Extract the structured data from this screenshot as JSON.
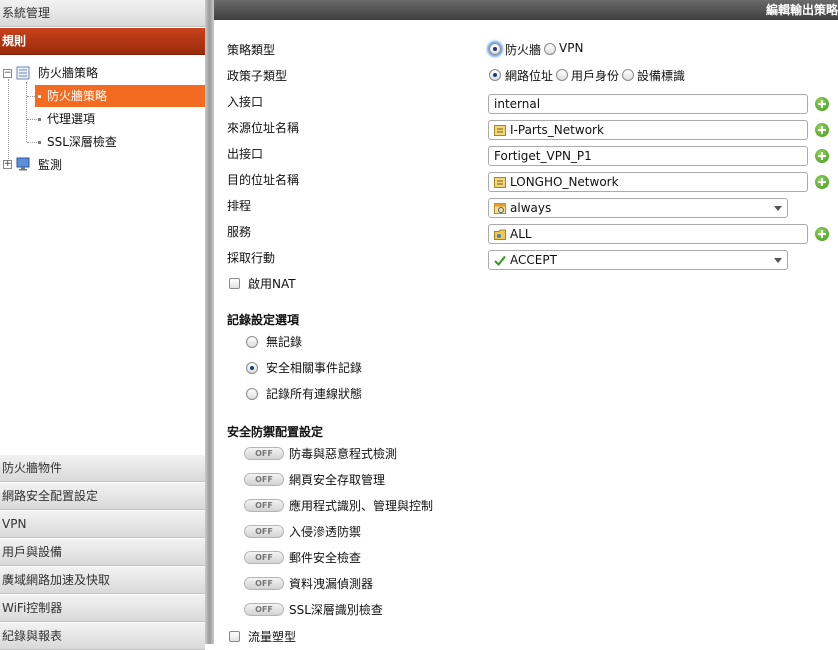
{
  "sidebar": {
    "sections_top": [
      "系統管理",
      "規則"
    ],
    "tree": {
      "root": "防火牆策略",
      "children": [
        "防火牆策略",
        "代理選項",
        "SSL深層檢查"
      ],
      "monitor": "監測"
    },
    "sections_bottom": [
      "防火牆物件",
      "網路安全配置設定",
      "VPN",
      "用戶與設備",
      "廣域網路加速及快取",
      "WiFi控制器",
      "紀錄與報表"
    ]
  },
  "header": {
    "title": "編輯輸出策略"
  },
  "form": {
    "policy_type": {
      "label": "策略類型",
      "options": [
        "防火牆",
        "VPN"
      ],
      "selected": "防火牆"
    },
    "policy_subtype": {
      "label": "政策子類型",
      "options": [
        "網路位址",
        "用戶身份",
        "設備標識"
      ],
      "selected": "網路位址"
    },
    "incoming_interface": {
      "label": "入接口",
      "value": "internal"
    },
    "source_address": {
      "label": "來源位址名稱",
      "value": "I-Parts_Network"
    },
    "outgoing_interface": {
      "label": "出接口",
      "value": "Fortiget_VPN_P1"
    },
    "destination_address": {
      "label": "目的位址名稱",
      "value": "LONGHO_Network"
    },
    "schedule": {
      "label": "排程",
      "value": "always"
    },
    "service": {
      "label": "服務",
      "value": "ALL"
    },
    "action": {
      "label": "採取行動",
      "value": "ACCEPT"
    },
    "enable_nat": {
      "label": "啟用NAT",
      "checked": false
    }
  },
  "logging": {
    "title": "記錄設定選項",
    "options": [
      "無記錄",
      "安全相關事件記錄",
      "記錄所有連線狀態"
    ],
    "selected": "安全相關事件記錄"
  },
  "security": {
    "title": "安全防禦配置設定",
    "toggle_label": "OFF",
    "items": [
      "防毒與惡意程式檢測",
      "網頁安全存取管理",
      "應用程式識別、管理與控制",
      "入侵滲透防禦",
      "郵件安全檢查",
      "資料洩漏偵測器",
      "SSL深層識別檢查"
    ]
  },
  "traffic_shaping": {
    "label": "流量塑型",
    "checked": false
  },
  "colors": {
    "active_section": "#b23414",
    "selected_tree": "#f26b21",
    "add_button": "#4caf2a"
  },
  "icons": {
    "add": "plus-circle-icon",
    "address": "address-card-icon",
    "schedule": "calendar-icon",
    "service": "service-folder-icon",
    "accept": "checkmark-icon"
  }
}
